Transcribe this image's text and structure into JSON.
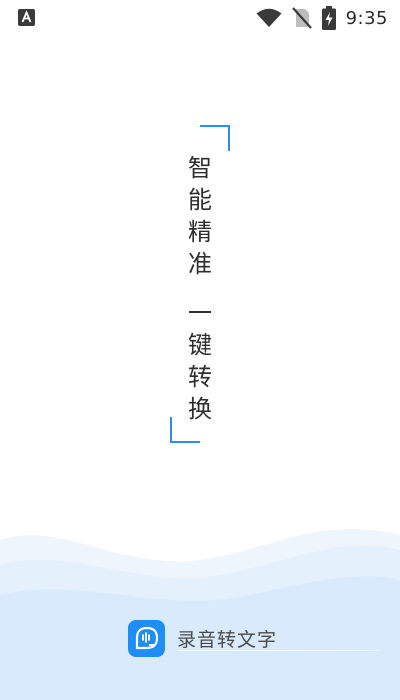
{
  "status_bar": {
    "time": "9:35",
    "notification_icon": "accessibility-a-icon",
    "wifi_icon": "wifi-icon",
    "sim_icon": "no-sim-icon",
    "battery_icon": "battery-charging-icon"
  },
  "slogan": {
    "line1_chars": [
      "智",
      "能",
      "精",
      "准"
    ],
    "line2_chars": [
      "一",
      "键",
      "转",
      "换"
    ]
  },
  "brand": {
    "name": "录音转文字",
    "logo_icon": "speech-bubble-soundwave-icon"
  },
  "colors": {
    "accent": "#2b8ef0",
    "logo_bg": "#1e8df5",
    "wave_light": "#e9f3fd",
    "wave_mid": "#d9eafb"
  }
}
